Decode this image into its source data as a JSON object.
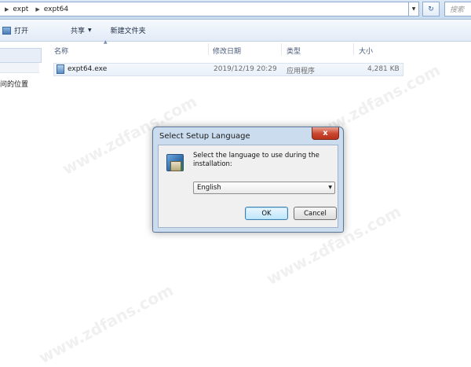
{
  "address_bar": {
    "crumbs": [
      "expt",
      "expt64"
    ],
    "search_placeholder": "搜索"
  },
  "toolbar": {
    "open_label": "打开",
    "share_label": "共享",
    "new_folder_label": "新建文件夹"
  },
  "nav_pane": {
    "recent_places_label": "问的位置"
  },
  "file_list": {
    "columns": [
      "名称",
      "修改日期",
      "类型",
      "大小"
    ],
    "rows": [
      {
        "name": "expt64.exe",
        "modified": "2019/12/19 20:29",
        "type": "应用程序",
        "size": "4,281 KB"
      }
    ]
  },
  "dialog": {
    "title": "Select Setup Language",
    "close_glyph": "x",
    "message": "Select the language to use during the installation:",
    "language_selected": "English",
    "ok_label": "OK",
    "cancel_label": "Cancel"
  },
  "watermark": "www.zdfans.com",
  "colors": {
    "address_bar_bg": "#dce8f5",
    "dialog_frame": "#cbdcef",
    "close_button": "#c9452d",
    "selected_row": "#e9f0fa"
  }
}
